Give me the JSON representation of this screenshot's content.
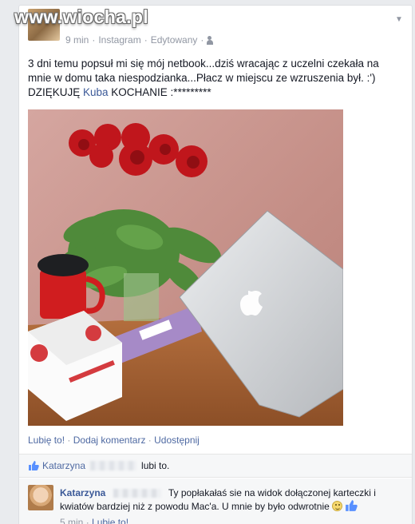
{
  "watermark": "www.wiocha.pl",
  "post": {
    "time": "9 min",
    "source": "Instagram",
    "edited": "Edytowany",
    "text_before": "3 dni temu popsuł mi się mój netbook...dziś wracając z uczelni czekała na mnie w domu taka niespodzianka...Płacz w miejscu ze wzruszenia był. :') DZIĘKUJĘ ",
    "mention": "Kuba",
    "text_after": " KOCHANIE :*********",
    "photo_alt": "Red roses, Milka chocolate, Raffaello box, red mug and a silver laptop on a wooden table"
  },
  "actions": {
    "like": "Lubię to!",
    "comment": "Dodaj komentarz",
    "share": "Udostępnij"
  },
  "likes": {
    "name": "Katarzyna",
    "suffix": "lubi to."
  },
  "comment": {
    "author": "Katarzyna",
    "text": "Ty popłakałaś sie na widok dołączonej karteczki i kwiatów bardziej niż z powodu Mac'a. U mnie by było odwrotnie",
    "time": "5 min",
    "like": "Lubię to!"
  }
}
